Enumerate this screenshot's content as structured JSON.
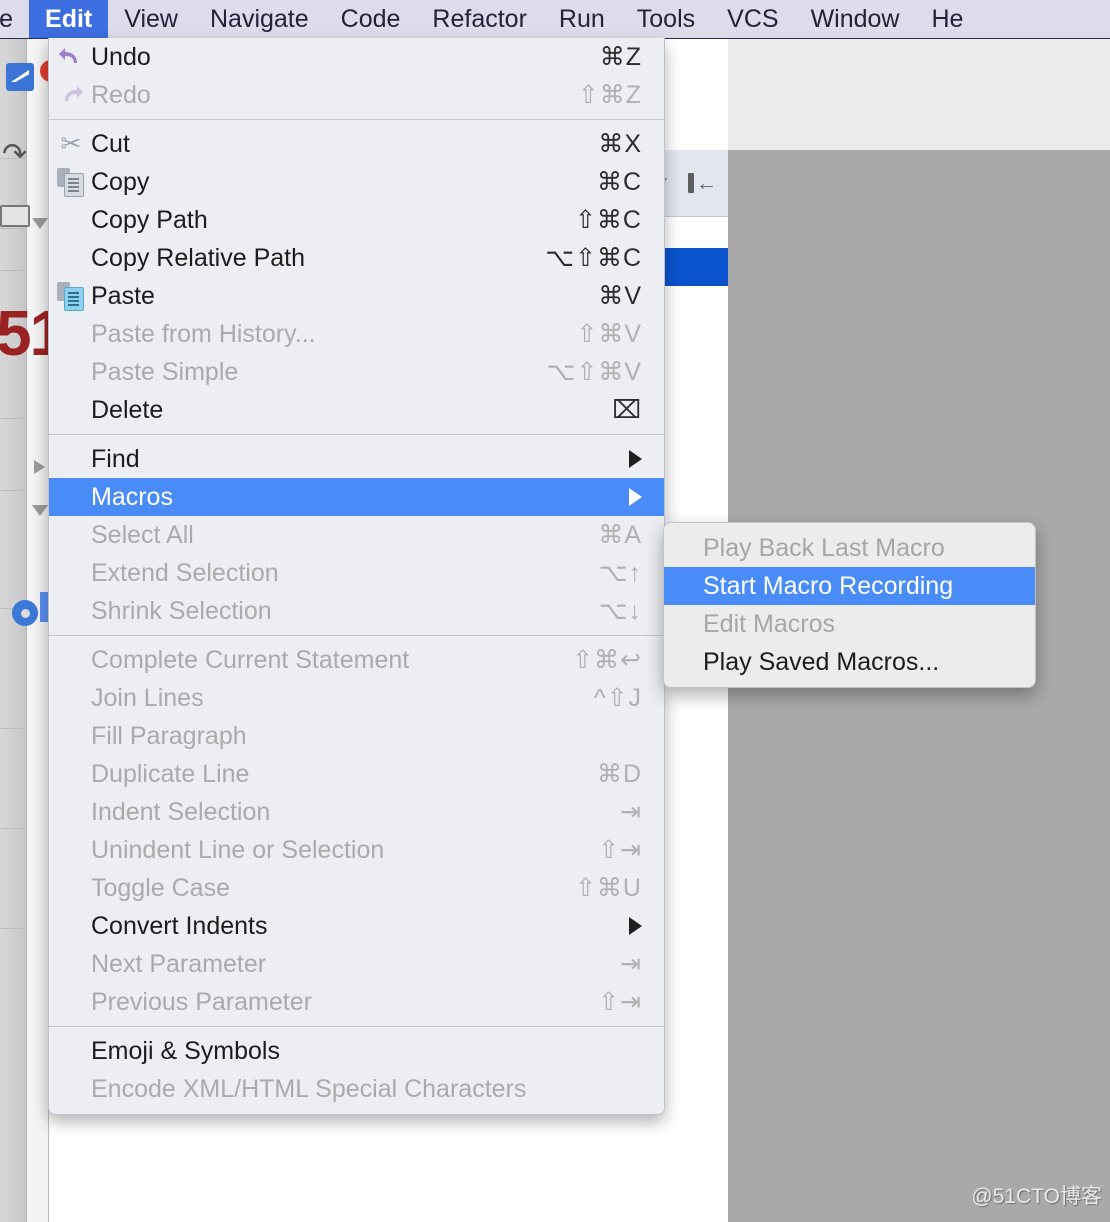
{
  "app": {
    "watermark": "@51CTO博客",
    "accent_blue": "#3c6ee0",
    "highlight_blue": "#4a8cf7",
    "menu_bg": "#eceef3",
    "menubar_bg": "#dcdcea",
    "selected_row_blue": "#0b53ce"
  },
  "menubar": {
    "items": [
      {
        "label": "ile",
        "active": false
      },
      {
        "label": "Edit",
        "active": true
      },
      {
        "label": "View",
        "active": false
      },
      {
        "label": "Navigate",
        "active": false
      },
      {
        "label": "Code",
        "active": false
      },
      {
        "label": "Refactor",
        "active": false
      },
      {
        "label": "Run",
        "active": false
      },
      {
        "label": "Tools",
        "active": false
      },
      {
        "label": "VCS",
        "active": false
      },
      {
        "label": "Window",
        "active": false
      },
      {
        "label": "He",
        "active": false
      }
    ]
  },
  "edit_menu": {
    "groups": [
      {
        "rows": [
          {
            "label": "Undo",
            "shortcut": "⌘Z",
            "icon": "undo-icon",
            "disabled": false,
            "submenu": false
          },
          {
            "label": "Redo",
            "shortcut": "⇧⌘Z",
            "icon": "redo-icon",
            "disabled": true,
            "submenu": false
          }
        ]
      },
      {
        "rows": [
          {
            "label": "Cut",
            "shortcut": "⌘X",
            "icon": "scissors-icon",
            "disabled": false,
            "submenu": false
          },
          {
            "label": "Copy",
            "shortcut": "⌘C",
            "icon": "copy-icon",
            "disabled": false,
            "submenu": false
          },
          {
            "label": "Copy Path",
            "shortcut": "⇧⌘C",
            "icon": "",
            "disabled": false,
            "submenu": false
          },
          {
            "label": "Copy Relative Path",
            "shortcut": "⌥⇧⌘C",
            "icon": "",
            "disabled": false,
            "submenu": false
          },
          {
            "label": "Paste",
            "shortcut": "⌘V",
            "icon": "paste-icon",
            "disabled": false,
            "submenu": false
          },
          {
            "label": "Paste from History...",
            "shortcut": "⇧⌘V",
            "icon": "",
            "disabled": true,
            "submenu": false
          },
          {
            "label": "Paste Simple",
            "shortcut": "⌥⇧⌘V",
            "icon": "",
            "disabled": true,
            "submenu": false
          },
          {
            "label": "Delete",
            "shortcut": "⌧",
            "icon": "",
            "disabled": false,
            "submenu": false
          }
        ]
      },
      {
        "rows": [
          {
            "label": "Find",
            "shortcut": "",
            "icon": "",
            "disabled": false,
            "submenu": true,
            "highlight": false
          },
          {
            "label": "Macros",
            "shortcut": "",
            "icon": "",
            "disabled": false,
            "submenu": true,
            "highlight": true
          },
          {
            "label": "Select All",
            "shortcut": "⌘A",
            "icon": "",
            "disabled": true,
            "submenu": false
          },
          {
            "label": "Extend Selection",
            "shortcut": "⌥↑",
            "icon": "",
            "disabled": true,
            "submenu": false
          },
          {
            "label": "Shrink Selection",
            "shortcut": "⌥↓",
            "icon": "",
            "disabled": true,
            "submenu": false
          }
        ]
      },
      {
        "rows": [
          {
            "label": "Complete Current Statement",
            "shortcut": "⇧⌘↩",
            "icon": "",
            "disabled": true,
            "submenu": false
          },
          {
            "label": "Join Lines",
            "shortcut": "^⇧J",
            "icon": "",
            "disabled": true,
            "submenu": false
          },
          {
            "label": "Fill Paragraph",
            "shortcut": "",
            "icon": "",
            "disabled": true,
            "submenu": false
          },
          {
            "label": "Duplicate Line",
            "shortcut": "⌘D",
            "icon": "",
            "disabled": true,
            "submenu": false
          },
          {
            "label": "Indent Selection",
            "shortcut": "⇥",
            "icon": "",
            "disabled": true,
            "submenu": false
          },
          {
            "label": "Unindent Line or Selection",
            "shortcut": "⇧⇥",
            "icon": "",
            "disabled": true,
            "submenu": false
          },
          {
            "label": "Toggle Case",
            "shortcut": "⇧⌘U",
            "icon": "",
            "disabled": true,
            "submenu": false
          },
          {
            "label": "Convert Indents",
            "shortcut": "",
            "icon": "",
            "disabled": false,
            "submenu": true
          },
          {
            "label": "Next Parameter",
            "shortcut": "⇥",
            "icon": "",
            "disabled": true,
            "submenu": false
          },
          {
            "label": "Previous Parameter",
            "shortcut": "⇧⇥",
            "icon": "",
            "disabled": true,
            "submenu": false
          }
        ]
      },
      {
        "rows": [
          {
            "label": "Emoji & Symbols",
            "shortcut": "",
            "icon": "",
            "disabled": false,
            "submenu": false
          },
          {
            "label": "Encode XML/HTML Special Characters",
            "shortcut": "",
            "icon": "",
            "disabled": true,
            "submenu": false
          }
        ]
      }
    ]
  },
  "macros_submenu": {
    "rows": [
      {
        "label": "Play Back Last Macro",
        "disabled": true,
        "highlight": false
      },
      {
        "label": "Start Macro Recording",
        "disabled": false,
        "highlight": true
      },
      {
        "label": "Edit Macros",
        "disabled": true,
        "highlight": false
      },
      {
        "label": "Play Saved Macros...",
        "disabled": false,
        "highlight": false
      }
    ]
  }
}
